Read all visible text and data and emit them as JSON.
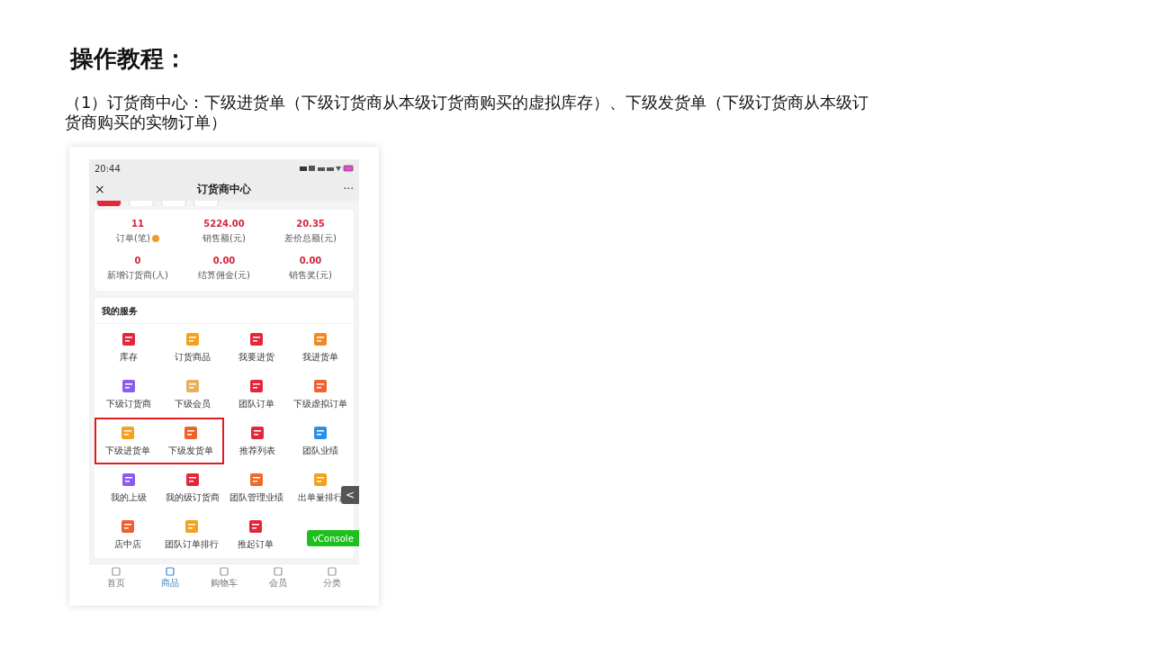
{
  "slide": {
    "title": "操作教程：",
    "paragraph": "（1）订货商中心：下级进货单（下级订货商从本级订货商购买的虚拟库存）、下级发货单（下级订货商从本级订货商购买的实物订单）"
  },
  "phone": {
    "status_bar": {
      "time": "20:44"
    },
    "nav_bar": {
      "close": "×",
      "title": "订货商中心",
      "more": "···"
    },
    "stats": [
      {
        "value": "11",
        "label": "订单(笔)",
        "info": true
      },
      {
        "value": "5224.00",
        "label": "销售额(元)",
        "info": false
      },
      {
        "value": "20.35",
        "label": "差价总额(元)",
        "info": false
      },
      {
        "value": "0",
        "label": "新增订货商(人)",
        "info": false
      },
      {
        "value": "0.00",
        "label": "结算佣金(元)",
        "info": false
      },
      {
        "value": "0.00",
        "label": "销售奖(元)",
        "info": false
      }
    ],
    "services": {
      "title": "我的服务",
      "rows": [
        [
          {
            "label": "库存",
            "highlighted": false
          },
          {
            "label": "订货商品",
            "highlighted": false
          },
          {
            "label": "我要进货",
            "highlighted": false
          },
          {
            "label": "我进货单",
            "highlighted": false
          }
        ],
        [
          {
            "label": "下级订货商",
            "highlighted": false
          },
          {
            "label": "下级会员",
            "highlighted": false
          },
          {
            "label": "团队订单",
            "highlighted": false
          },
          {
            "label": "下级虚拟订单",
            "highlighted": false
          }
        ],
        [
          {
            "label": "下级进货单",
            "highlighted": true
          },
          {
            "label": "下级发货单",
            "highlighted": true
          },
          {
            "label": "推荐列表",
            "highlighted": false
          },
          {
            "label": "团队业绩",
            "highlighted": false
          }
        ],
        [
          {
            "label": "我的上级",
            "highlighted": false
          },
          {
            "label": "我的级订货商",
            "highlighted": false
          },
          {
            "label": "团队管理业绩",
            "highlighted": false
          },
          {
            "label": "出单量排行",
            "highlighted": false
          }
        ],
        [
          {
            "label": "店中店",
            "highlighted": false
          },
          {
            "label": "团队订单排行",
            "highlighted": false
          },
          {
            "label": "推起订单",
            "highlighted": false
          }
        ]
      ]
    },
    "side_tab": "<",
    "vconsole": "vConsole",
    "tab_bar": [
      {
        "label": "首页",
        "selected": false
      },
      {
        "label": "商品",
        "selected": true
      },
      {
        "label": "购物车",
        "selected": false
      },
      {
        "label": "会员",
        "selected": false
      },
      {
        "label": "分类",
        "selected": false
      }
    ]
  }
}
